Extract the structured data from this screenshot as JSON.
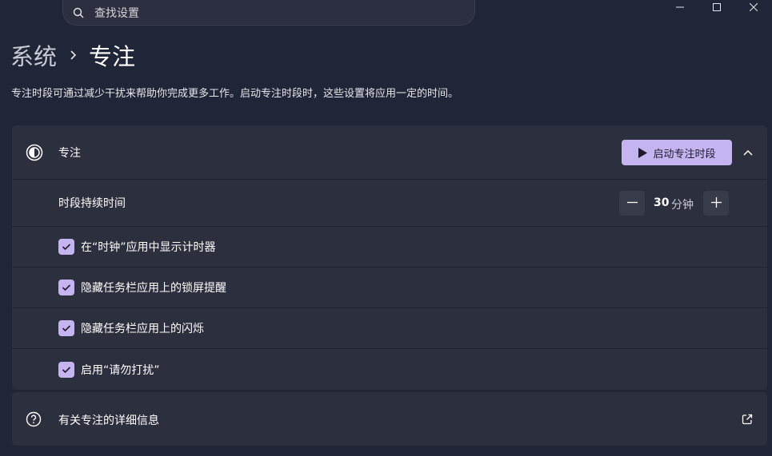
{
  "search": {
    "placeholder": "查找设置",
    "icon": "search-icon"
  },
  "window_controls": [
    "minimize-icon",
    "maximize-icon",
    "close-icon"
  ],
  "breadcrumb": {
    "parent": "系统",
    "separator": "›",
    "current": "专注"
  },
  "description": "专注时段可通过减少干扰来帮助你完成更多工作。启动专注时段时，这些设置将应用一定的时间。",
  "focus": {
    "title": "专注",
    "start_button": "启动专注时段",
    "duration": {
      "label": "时段持续时间",
      "value": "30",
      "unit": "分钟"
    },
    "options": [
      {
        "label": "在“时钟”应用中显示计时器",
        "checked": true
      },
      {
        "label": "隐藏任务栏应用上的锁屏提醒",
        "checked": true
      },
      {
        "label": "隐藏任务栏应用上的闪烁",
        "checked": true
      },
      {
        "label": "启用“请勿打扰”",
        "checked": true
      }
    ]
  },
  "info": {
    "label": "有关专注的详细信息"
  },
  "colors": {
    "background": "#202537",
    "card": "#2c2f3e",
    "accent": "#c4b5f1"
  }
}
